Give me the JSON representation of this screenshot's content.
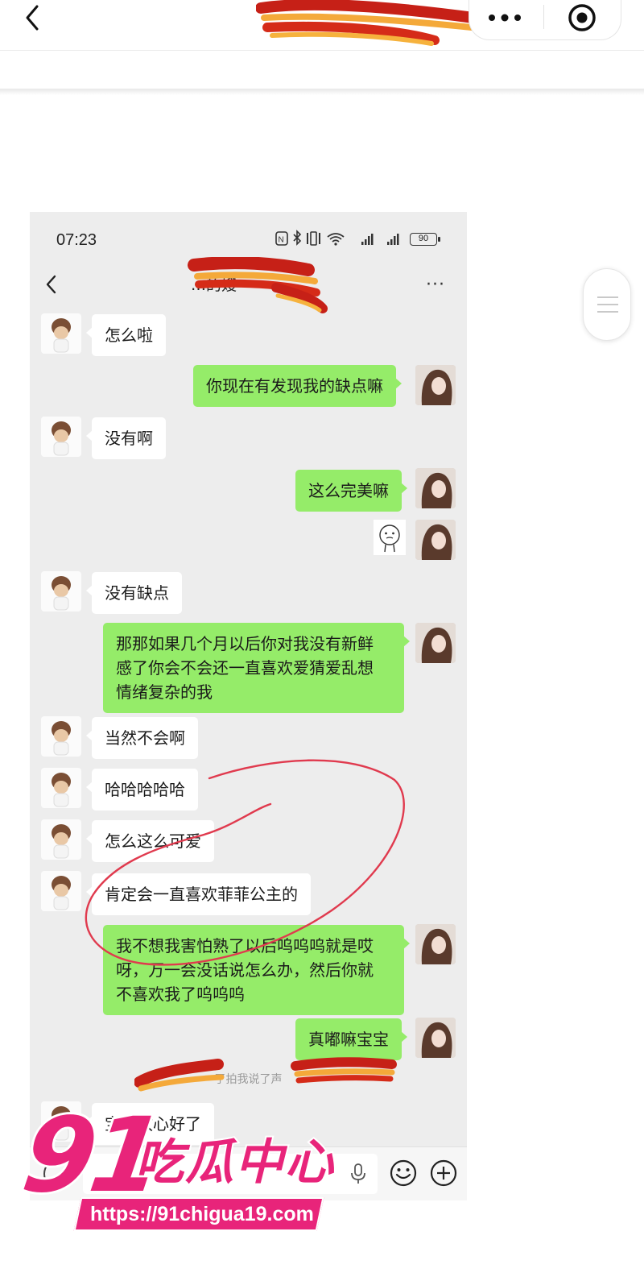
{
  "outer": {
    "back_icon": "chevron-left-icon",
    "more_icon": "more-dots-icon",
    "target_icon": "target-icon"
  },
  "phone": {
    "status_time": "07:23",
    "battery": "90",
    "chat_title": "…的嫂",
    "more": "···"
  },
  "messages": [
    {
      "side": "left",
      "text": "怎么啦"
    },
    {
      "side": "right",
      "text": "你现在有发现我的缺点嘛"
    },
    {
      "side": "left",
      "text": "没有啊"
    },
    {
      "side": "right",
      "text": "这么完美嘛"
    },
    {
      "side": "left",
      "text": "没有缺点"
    },
    {
      "side": "right",
      "text": "那那如果几个月以后你对我没有新鲜\n感了你会不会还一直喜欢爱猜爱乱想\n情绪复杂的我"
    },
    {
      "side": "left",
      "text": "当然不会啊"
    },
    {
      "side": "left",
      "text": "哈哈哈哈哈"
    },
    {
      "side": "left",
      "text": "怎么这么可爱"
    },
    {
      "side": "left",
      "text": "肯定会一直喜欢菲菲公主的"
    },
    {
      "side": "right",
      "text": "我不想我害怕熟了以后呜呜呜就是哎\n呀，万一会没话说怎么办，然后你就\n不喜欢我了呜呜呜"
    },
    {
      "side": "right",
      "text": "真嘟嘛宝宝"
    },
    {
      "side": "left",
      "text": "宝宝放心好了"
    }
  ],
  "system_message": "了拍我说了声",
  "watermark": {
    "number": "91",
    "name": "吃瓜中心",
    "url": "https://91chigua19.com"
  },
  "colors": {
    "chat_bg": "#ededed",
    "right_bubble": "#95ec69",
    "left_bubble": "#ffffff",
    "watermark": "#e8247a",
    "annotation": "#e03a4e"
  }
}
